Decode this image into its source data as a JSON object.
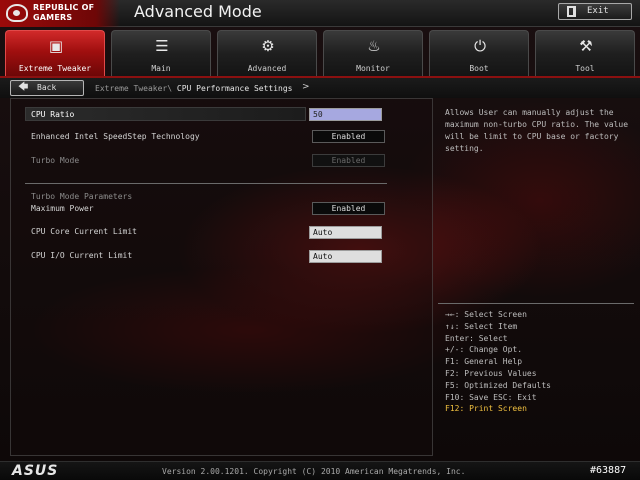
{
  "header": {
    "brand_line1": "REPUBLIC OF",
    "brand_line2": "GAMERS",
    "title": "Advanced Mode",
    "exit_label": "Exit"
  },
  "tabs": [
    {
      "label": "Extreme Tweaker",
      "icon": "cpu-chip-icon",
      "glyph": "▣",
      "active": true
    },
    {
      "label": "Main",
      "icon": "list-icon",
      "glyph": "☰",
      "active": false
    },
    {
      "label": "Advanced",
      "icon": "settings-info-icon",
      "glyph": "⚙",
      "active": false
    },
    {
      "label": "Monitor",
      "icon": "monitor-gauge-icon",
      "glyph": "♨",
      "active": false
    },
    {
      "label": "Boot",
      "icon": "power-icon",
      "glyph": "⏻",
      "active": false
    },
    {
      "label": "Tool",
      "icon": "tool-icon",
      "glyph": "⚒",
      "active": false
    }
  ],
  "nav": {
    "back_label": "Back",
    "breadcrumb_parent": "Extreme Tweaker\\ ",
    "breadcrumb_current": "CPU Performance Settings",
    "breadcrumb_suffix": ">"
  },
  "settings": {
    "cpu_ratio": {
      "label": "CPU Ratio",
      "value": "50"
    },
    "speedstep": {
      "label": "Enhanced Intel SpeedStep Technology",
      "value": "Enabled"
    },
    "turbo_mode": {
      "label": "Turbo Mode",
      "value": "Enabled"
    },
    "section_title": "Turbo Mode Parameters",
    "max_power": {
      "label": "Maximum Power",
      "value": "Enabled"
    },
    "core_current": {
      "label": "CPU Core Current Limit",
      "value": "Auto"
    },
    "io_current": {
      "label": "CPU I/O Current Limit",
      "value": "Auto"
    }
  },
  "help": {
    "description": "Allows User can manually adjust the maximum non-turbo CPU ratio. The value will be limit to CPU base or factory setting.",
    "keys": [
      "→←: Select Screen",
      "↑↓: Select Item",
      "Enter: Select",
      "+/-: Change Opt.",
      "F1: General Help",
      "F2: Previous Values",
      "F5: Optimized Defaults",
      "F10: Save  ESC: Exit",
      "F12: Print Screen"
    ]
  },
  "footer": {
    "logo": "ASUS",
    "version": "Version 2.00.1201. Copyright (C) 2010 American Megatrends, Inc.",
    "screen_id": "#63887"
  }
}
